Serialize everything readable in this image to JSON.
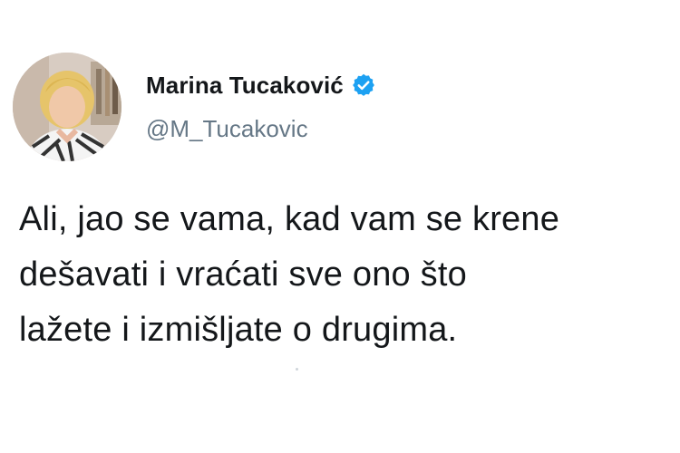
{
  "author": {
    "display_name": "Marina Tucaković",
    "handle": "@M_Tucakovic",
    "verified": true,
    "verified_icon": "verified-badge-icon",
    "verified_color": "#1da1f2"
  },
  "tweet": {
    "lines": [
      "Ali, jao se vama, kad vam se krene",
      "dešavati i vraćati sve ono što",
      "lažete i izmišljate o drugima."
    ]
  },
  "colors": {
    "text": "#14171a",
    "handle": "#657786",
    "background": "#ffffff"
  }
}
